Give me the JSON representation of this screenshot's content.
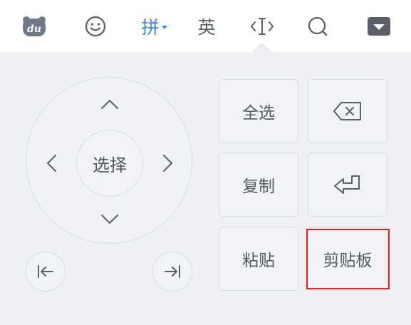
{
  "toolbar": {
    "items": [
      {
        "icon": "du-logo-icon",
        "label": "du"
      },
      {
        "icon": "emoji-icon"
      },
      {
        "label": "拼",
        "color": "#3b84e6"
      },
      {
        "label": "英"
      },
      {
        "icon": "cursor-edit-icon"
      },
      {
        "icon": "search-icon"
      },
      {
        "icon": "collapse-keyboard-icon"
      }
    ]
  },
  "edit_panel": {
    "dpad": {
      "center_label": "选择",
      "up": "chevron-up-icon",
      "down": "chevron-down-icon",
      "left": "chevron-left-icon",
      "right": "chevron-right-icon",
      "home": "move-to-start-icon",
      "end": "move-to-end-icon"
    },
    "keys": {
      "select_all": "全选",
      "delete": "backspace-icon",
      "copy": "复制",
      "enter": "enter-icon",
      "paste": "粘贴",
      "clipboard": "剪贴板"
    },
    "highlight_color": "#d6262b"
  }
}
